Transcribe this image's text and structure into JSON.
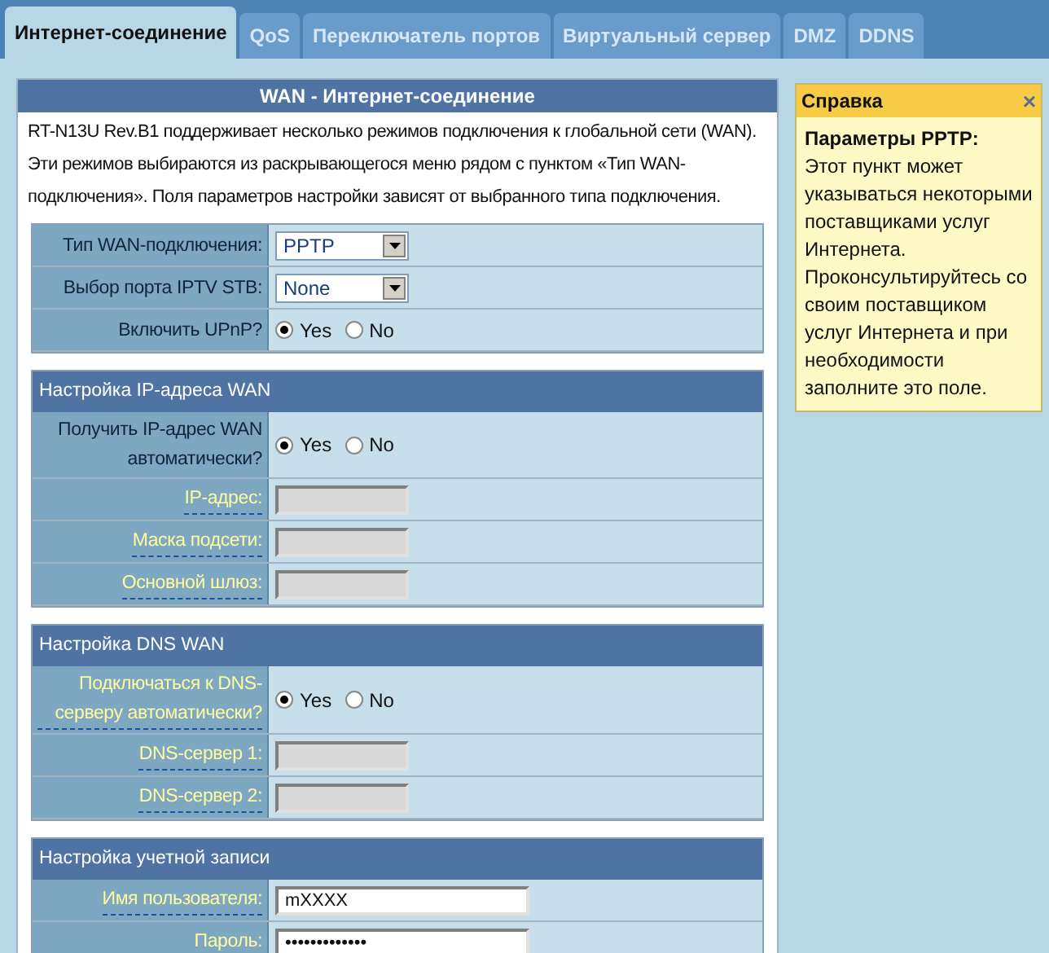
{
  "tabs": [
    {
      "label": "Интернет-соединение",
      "selected": true
    },
    {
      "label": "QoS",
      "selected": false
    },
    {
      "label": "Переключатель портов",
      "selected": false
    },
    {
      "label": "Виртуальный сервер",
      "selected": false
    },
    {
      "label": "DMZ",
      "selected": false
    },
    {
      "label": "DDNS",
      "selected": false
    }
  ],
  "main": {
    "title": "WAN - Интернет-соединение",
    "description": "RT-N13U Rev.B1 поддерживает несколько режимов подключения к глобальной сети (WAN). Эти режимов выбираются из раскрывающегося меню рядом с пунктом «Тип WAN-подключения». Поля параметров настройки зависят от выбранного типа подключения.",
    "sections": [
      {
        "rows": [
          {
            "label": "Тип WAN-подключения:",
            "link": false,
            "kind": "select",
            "value": "PPTP"
          },
          {
            "label": "Выбор порта IPTV STB:",
            "link": false,
            "kind": "select",
            "value": "None"
          },
          {
            "label": "Включить UPnP?",
            "link": false,
            "kind": "radio",
            "options": [
              {
                "label": "Yes",
                "selected": true
              },
              {
                "label": "No",
                "selected": false
              }
            ]
          }
        ]
      },
      {
        "title": "Настройка IP-адреса WAN",
        "rows": [
          {
            "label": "Получить IP-адрес WAN автоматически?",
            "link": false,
            "kind": "radio",
            "options": [
              {
                "label": "Yes",
                "selected": true
              },
              {
                "label": "No",
                "selected": false
              }
            ]
          },
          {
            "label": "IP-адрес:",
            "link": true,
            "kind": "text",
            "disabled": true
          },
          {
            "label": "Маска подсети:",
            "link": true,
            "kind": "text",
            "disabled": true
          },
          {
            "label": "Основной шлюз:",
            "link": true,
            "kind": "text",
            "disabled": true
          }
        ]
      },
      {
        "title": "Настройка DNS WAN",
        "rows": [
          {
            "label": "Подключаться к DNS-серверу автоматически?",
            "link": true,
            "kind": "radio",
            "options": [
              {
                "label": "Yes",
                "selected": true
              },
              {
                "label": "No",
                "selected": false
              }
            ]
          },
          {
            "label": "DNS-сервер 1:",
            "link": true,
            "kind": "text",
            "disabled": true
          },
          {
            "label": "DNS-сервер 2:",
            "link": true,
            "kind": "text",
            "disabled": true
          }
        ]
      },
      {
        "title": "Настройка учетной записи",
        "rows": [
          {
            "label": "Имя пользователя:",
            "link": true,
            "kind": "text",
            "disabled": false,
            "value": "mXXXX"
          },
          {
            "label": "Пароль:",
            "link": true,
            "kind": "text",
            "disabled": false,
            "value": "•••••••••••••"
          }
        ]
      }
    ]
  },
  "help": {
    "title": "Справка",
    "close": "×",
    "heading": "Параметры PPTP:",
    "text": "Этот пункт может указываться некоторыми поставщиками услуг Интернета. Проконсультируйтесь со своим поставщиком услуг Интернета и при необходимости заполните это поле."
  }
}
